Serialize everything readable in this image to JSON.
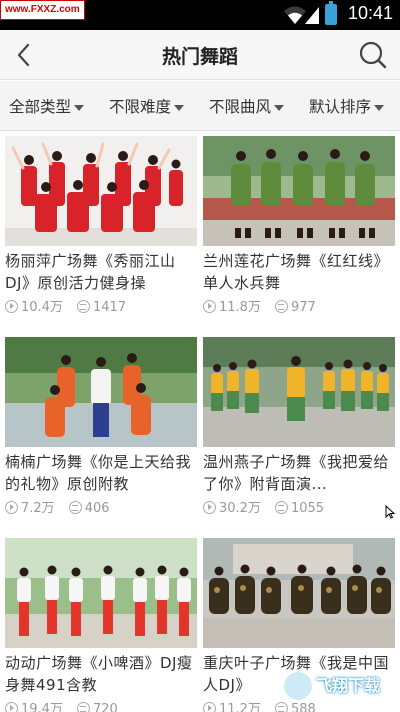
{
  "status_bar": {
    "watermark_text": "www.FXXZ.com",
    "time": "10:41",
    "icons": [
      "wifi-icon",
      "signal-icon",
      "battery-icon"
    ]
  },
  "header": {
    "title": "热门舞蹈",
    "back_icon": "chevron-left-icon",
    "search_icon": "search-icon"
  },
  "filters": [
    {
      "label": "全部类型"
    },
    {
      "label": "不限难度"
    },
    {
      "label": "不限曲风"
    },
    {
      "label": "默认排序"
    }
  ],
  "videos": [
    {
      "title": "杨丽萍广场舞《秀丽江山DJ》原创活力健身操",
      "views": "10.4万",
      "comments": "1417"
    },
    {
      "title": "兰州莲花广场舞《红红线》单人水兵舞",
      "views": "11.8万",
      "comments": "977"
    },
    {
      "title": "楠楠广场舞《你是上天给我的礼物》原创附教",
      "views": "7.2万",
      "comments": "406"
    },
    {
      "title": "温州燕子广场舞《我把爱给了你》附背面演...",
      "views": "30.2万",
      "comments": "1055"
    },
    {
      "title": "动动广场舞《小啤酒》DJ瘦身舞491含教",
      "views": "19.4万",
      "comments": "720"
    },
    {
      "title": "重庆叶子广场舞《我是中国人DJ》",
      "views": "11.2万",
      "comments": "588"
    }
  ],
  "bottom_watermark": {
    "text": "飞翔下载"
  },
  "colors": {
    "status_bar": "#000000",
    "header_bg": "#f7f7f7",
    "filter_bg": "#f4f4f4",
    "battery": "#3aa0d8",
    "meta_text": "#999999"
  }
}
